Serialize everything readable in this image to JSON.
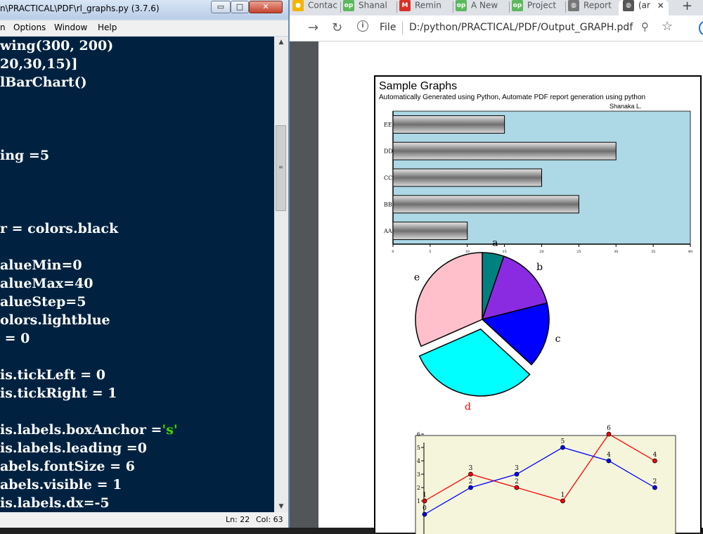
{
  "idle": {
    "title": "n\\PRACTICAL\\PDF\\rl_graphs.py (3.7.6)",
    "menu": [
      "n",
      "Options",
      "Window",
      "Help"
    ],
    "window_buttons": {
      "minimize": "▭",
      "maximize": "□",
      "close": "✕"
    },
    "code_lines": [
      "wing(300, 200)",
      "20,30,15)]",
      "lBarChart()",
      "",
      "",
      "",
      "ing =5",
      "",
      "",
      "",
      "r = colors.black",
      "",
      "alueMin=0",
      "alueMax=40",
      "alueStep=5",
      "olors.lightblue",
      " = 0",
      "",
      "is.tickLeft = 0",
      "is.tickRight = 1",
      "",
      "is.labels.boxAnchor =",
      "is.labels.leading =0",
      "abels.fontSize = 6",
      "abels.visible = 1",
      "is.labels.dx=-5"
    ],
    "code_string_token": "'s'",
    "status": {
      "line": "Ln: 22",
      "col": "Col: 63"
    }
  },
  "chrome": {
    "tabs": [
      {
        "label": "Contac",
        "icon": "contacts-tab-icon",
        "color": "#f4b400"
      },
      {
        "label": "Shanal",
        "icon": "op-tab-icon",
        "color": "#5cb85c"
      },
      {
        "label": "Remin",
        "icon": "gmail-tab-icon",
        "color": "#d93025"
      },
      {
        "label": "A New",
        "icon": "op-tab-icon",
        "color": "#5cb85c"
      },
      {
        "label": "Project",
        "icon": "op-tab-icon",
        "color": "#5cb85c"
      },
      {
        "label": "Report",
        "icon": "globe-tab-icon",
        "color": "#777777"
      },
      {
        "label": "(ar",
        "icon": "globe-tab-icon",
        "color": "#555555"
      }
    ],
    "tab_close": "✕",
    "new_tab": "+",
    "omnibox": {
      "scheme_label": "File",
      "url": "D:/python/PRACTICAL/PDF/Output_GRAPH.pdf"
    }
  },
  "report": {
    "title": "Sample Graphs",
    "subtitle": "Automatically Generated using Python, Automate PDF report generation using python",
    "author": "Shanaka L."
  },
  "chart_data": [
    {
      "type": "bar",
      "orientation": "horizontal",
      "categories": [
        "AA",
        "BB",
        "CC",
        "DD",
        "EE"
      ],
      "values": [
        10,
        25,
        20,
        30,
        15
      ],
      "xlim": [
        0,
        40
      ],
      "x_ticks": [
        0,
        5,
        10,
        15,
        20,
        25,
        30,
        35,
        40
      ],
      "background": "#add8e6",
      "bar_color": "#a0a0a0"
    },
    {
      "type": "pie",
      "labels": [
        "a",
        "b",
        "c",
        "d",
        "e"
      ],
      "values": [
        5,
        15,
        15,
        30,
        30
      ],
      "colors": [
        "#008080",
        "#8a2be2",
        "#0000ff",
        "#00ffff",
        "#ffc0cb"
      ],
      "exploded": "d",
      "highlight_label_color": "#ff0000"
    },
    {
      "type": "line",
      "x": [
        1,
        2,
        3,
        4,
        5,
        6
      ],
      "series": [
        {
          "values": [
            1,
            3,
            2,
            1,
            6,
            4
          ],
          "color": "#ff0000"
        },
        {
          "values": [
            0,
            2,
            3,
            5,
            4,
            2
          ],
          "color": "#0000ff"
        }
      ],
      "ylim": [
        0,
        6
      ],
      "y_ticks": [
        1,
        2,
        3,
        4,
        5,
        6
      ],
      "background": "#f5f5dc"
    }
  ]
}
